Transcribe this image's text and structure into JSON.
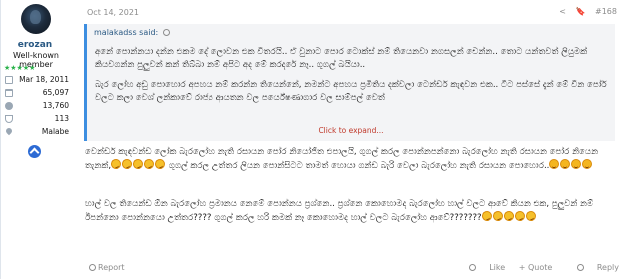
{
  "user": {
    "username": "erozan",
    "title": "Well-known member",
    "stars": "★★★★★",
    "stats": [
      {
        "icon": "calendar-icon",
        "value": "Mar 18, 2011"
      },
      {
        "icon": "messages-icon",
        "value": "65,097"
      },
      {
        "icon": "reactions-icon",
        "value": "13,760"
      },
      {
        "icon": "trophy-icon",
        "value": "113"
      },
      {
        "icon": "location-icon",
        "value": "Malabe"
      }
    ]
  },
  "post": {
    "date": "Oct 14, 2021",
    "share_glyph": "<",
    "bookmark_glyph": "🔖",
    "number": "#168"
  },
  "quote": {
    "author": "malakadss said:",
    "lines": [
      "අනේ පොන්නයා දන්න එකම දේ ලොවන එක විතරයි.. ඒ වුනාට පොර ටොක්ස් නම් තියෙනවා නගසලන් චෙන්න.. තොට යන්තවත් ලියුමක් කියවගන්න පුලුවන් කන් තිබ්බා නම් අපිට අද මේ කරදරේ නෑ.. ගුගල් බයියා..",
      "බැර ලෝහ අඩු පොහොර අපහය නම් කරන්න තියෙන්නේ, නමන්ට අපහය ප්‍රමිතිය දක්වලා ටෙන්ඩර් කැඳවන එක.. ටීට පස්සේ දැන් මේ වීන පෝර් වලට කලා වෙශ් ලන්කාවේ රාජ්‍ය ආයතන වල පර්යේෂණාගාර වල සාම්පල් වෙත්"
    ],
    "expand_label": "Click to expand..."
  },
  "content": {
    "para1": "වෙන්ඩර් කැඳවන්ඩ ලෝක බැරලෝහ නැති රසායන පෝර නියෝජිත එපාලයි, ගුගල් කරල පොන්නපන්නො බැරලෝහ නැති රසායන පෝර නියෙන තැනක්,",
    "para1b": "ගුගල් කරල උත්තර ලියන පොන්සිටට තාමත් හොයා ගන්ඩ බැරි වෙලා බැරලෝහ නැති රසායන පොහොර..",
    "para2": "හාල් වල තියෙන්ඩ ඕන බැරලෝහ ප්‍රමානය නෙමේ පොන්නය ප්‍රශ්නෙ.. ප්‍රශ්නෙ කොහොමද බැරලෝහ හාල් වලට ආවේ කියන එක, පුලුවන් නම් ඊපන්නො පොන්නයො උත්තර???? ගුගල් කරල හරි කමක් නෑ කොහොමද හාල් වලට බැරලෝහ ආවේ???????"
  },
  "footer": {
    "report_label": "Report",
    "like_label": "Like",
    "quote_label": "+ Quote",
    "reply_label": "Reply"
  },
  "colors": {
    "accent": "#3d8ee0",
    "username": "#2b5a84",
    "expand": "#c0392b",
    "stars": "#2ab24a"
  }
}
